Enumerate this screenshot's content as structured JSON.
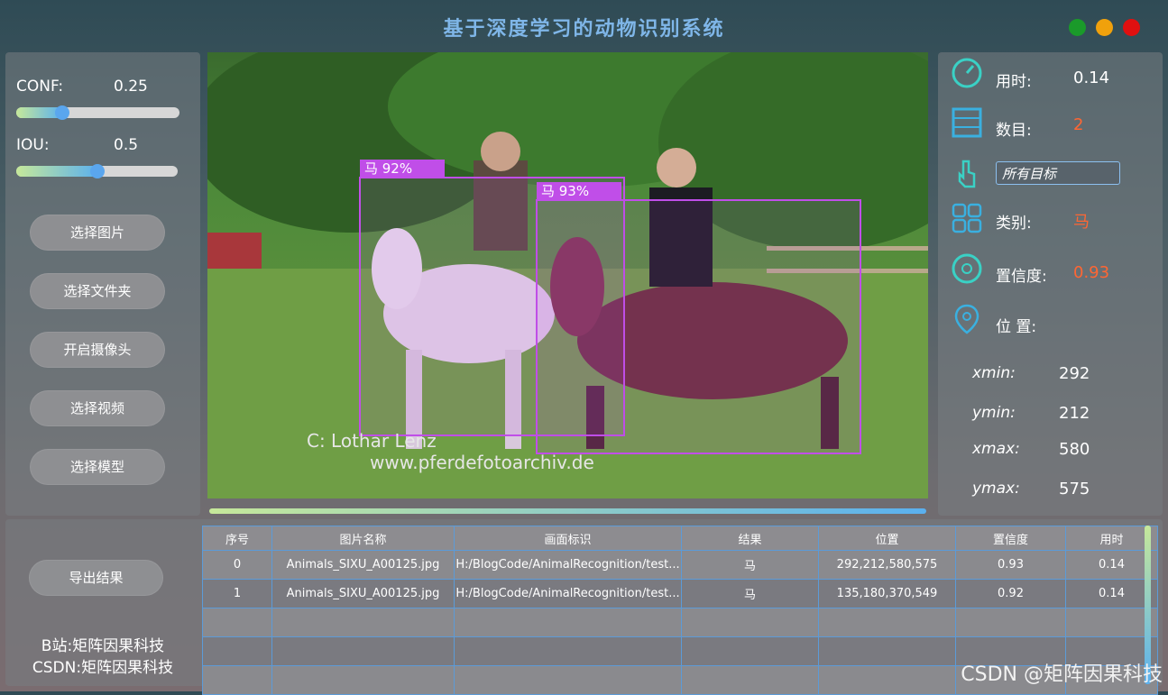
{
  "window": {
    "title": "基于深度学习的动物识别系统",
    "controls": [
      {
        "name": "minimize",
        "color": "#1a9a2a"
      },
      {
        "name": "maximize",
        "color": "#f0a10c"
      },
      {
        "name": "close",
        "color": "#e01010"
      }
    ]
  },
  "left_panel": {
    "conf_label": "CONF:",
    "conf_value": "0.25",
    "conf_level": 0.25,
    "iou_label": "IOU:",
    "iou_value": "0.5",
    "iou_level": 0.5,
    "buttons": [
      "选择图片",
      "选择文件夹",
      "开启摄像头",
      "选择视频",
      "选择模型"
    ]
  },
  "viewer": {
    "detections": [
      {
        "label": "马 92%",
        "color": "#c04ee8"
      },
      {
        "label": "马 93%",
        "color": "#c04ee8"
      }
    ],
    "photo_text": [
      "C: Lothar Lenz",
      "www.pferdefotoarchiv.de"
    ],
    "progress": 1.0
  },
  "right_panel": {
    "time_label": "用时:",
    "time_value": "0.14",
    "count_label": "数目:",
    "count_value": "2",
    "target_select": "所有目标",
    "class_label": "类别:",
    "class_value": "马",
    "conf_label": "置信度:",
    "conf_value": "0.93",
    "pos_label": "位 置:",
    "xmin_label": "xmin:",
    "xmin": "292",
    "ymin_label": "ymin:",
    "ymin": "212",
    "xmax_label": "xmax:",
    "xmax": "580",
    "ymax_label": "ymax:",
    "ymax": "575",
    "accent": "#ff6633"
  },
  "bottom_panel": {
    "export_button": "导出结果",
    "credit_line1": "B站:矩阵因果科技",
    "credit_line2": "CSDN:矩阵因果科技"
  },
  "table": {
    "headers": [
      "序号",
      "图片名称",
      "画面标识",
      "结果",
      "位置",
      "置信度",
      "用时"
    ],
    "rows": [
      [
        "0",
        "Animals_SIXU_A00125.jpg",
        "H:/BlogCode/AnimalRecognition/test...",
        "马",
        "292,212,580,575",
        "0.93",
        "0.14"
      ],
      [
        "1",
        "Animals_SIXU_A00125.jpg",
        "H:/BlogCode/AnimalRecognition/test...",
        "马",
        "135,180,370,549",
        "0.92",
        "0.14"
      ],
      [
        "",
        "",
        "",
        "",
        "",
        "",
        ""
      ],
      [
        "",
        "",
        "",
        "",
        "",
        "",
        ""
      ],
      [
        "",
        "",
        "",
        "",
        "",
        "",
        ""
      ]
    ]
  },
  "watermark": "CSDN @矩阵因果科技"
}
